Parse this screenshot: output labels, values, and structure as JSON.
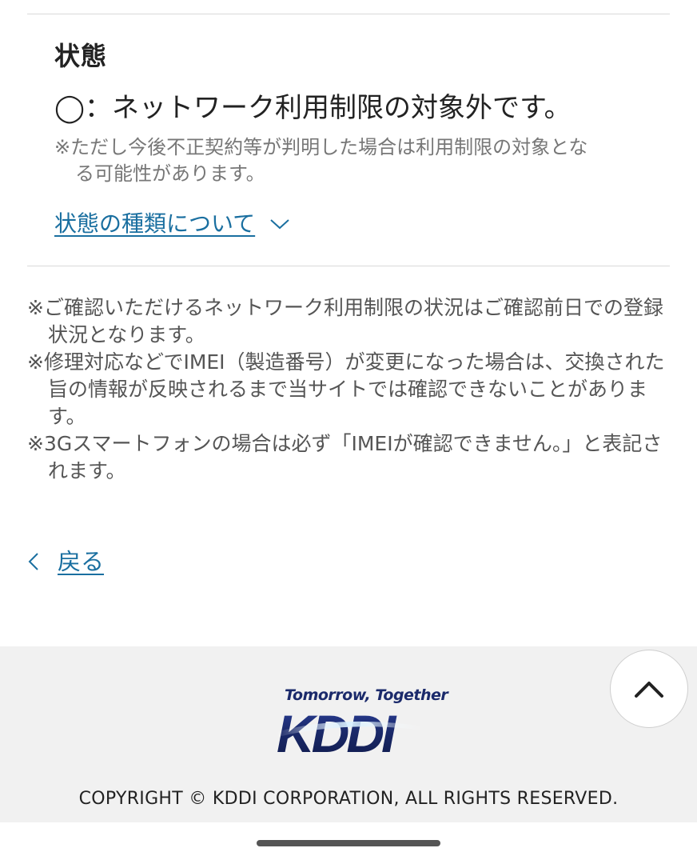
{
  "status_section": {
    "title": "状態",
    "result": "◯：ネットワーク利用制限の対象外です。",
    "note_line1": "※ただし今後不正契約等が判明した場合は利用制限の対象とな",
    "note_line2": "る可能性があります。",
    "types_link": "状態の種類について"
  },
  "notes": [
    "※ご確認いただけるネットワーク利用制限の状況はご確認前日での登録状況となります。",
    "※修理対応などでIMEI（製造番号）が変更になった場合は、交換された旨の情報が反映されるまで当サイトでは確認できないことがあります。",
    "※3Gスマートフォンの場合は必ず「IMEIが確認できません。」と表記されます。"
  ],
  "back_link": "戻る",
  "footer": {
    "tagline": "Tomorrow, Together",
    "logo_text": "KDDI",
    "copyright": "COPYRIGHT © KDDI CORPORATION, ALL RIGHTS RESERVED."
  },
  "colors": {
    "link": "#1a6fa0",
    "logo_blue": "#1b2a6b",
    "footer_bg": "#f1f1f1"
  },
  "icons": {
    "expand": "chevron-down-icon",
    "back": "chevron-left-icon",
    "scroll_top": "chevron-up-icon"
  }
}
